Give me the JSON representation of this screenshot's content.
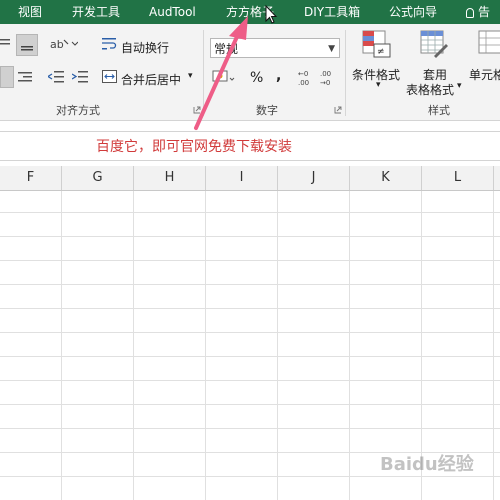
{
  "menu_tabs": [
    {
      "label": "视图"
    },
    {
      "label": "开发工具"
    },
    {
      "label": "AudTool"
    },
    {
      "label": "方方格子"
    },
    {
      "label": "DIY工具箱"
    },
    {
      "label": "公式向导"
    },
    {
      "label": "告"
    }
  ],
  "ribbon": {
    "alignment": {
      "wrap_text": "自动换行",
      "merge_center": "合并后居中",
      "group_label": "对齐方式"
    },
    "number": {
      "format_value": "常规",
      "percent_symbol": "%",
      "comma_symbol": ",",
      "group_label": "数字"
    },
    "styles": {
      "conditional_format": "条件格式",
      "table_format_line1": "套用",
      "table_format_line2": "表格格式",
      "cell_styles": "单元格",
      "group_label": "样式"
    }
  },
  "annotation": {
    "text": "百度它，即可官网免费下载安装",
    "color": "#d13b3b",
    "arrow_color": "#ee5d87"
  },
  "columns": [
    "F",
    "G",
    "H",
    "I",
    "J",
    "K",
    "L"
  ],
  "watermark": "Baidu经验",
  "colors": {
    "tabbar": "#217346"
  }
}
